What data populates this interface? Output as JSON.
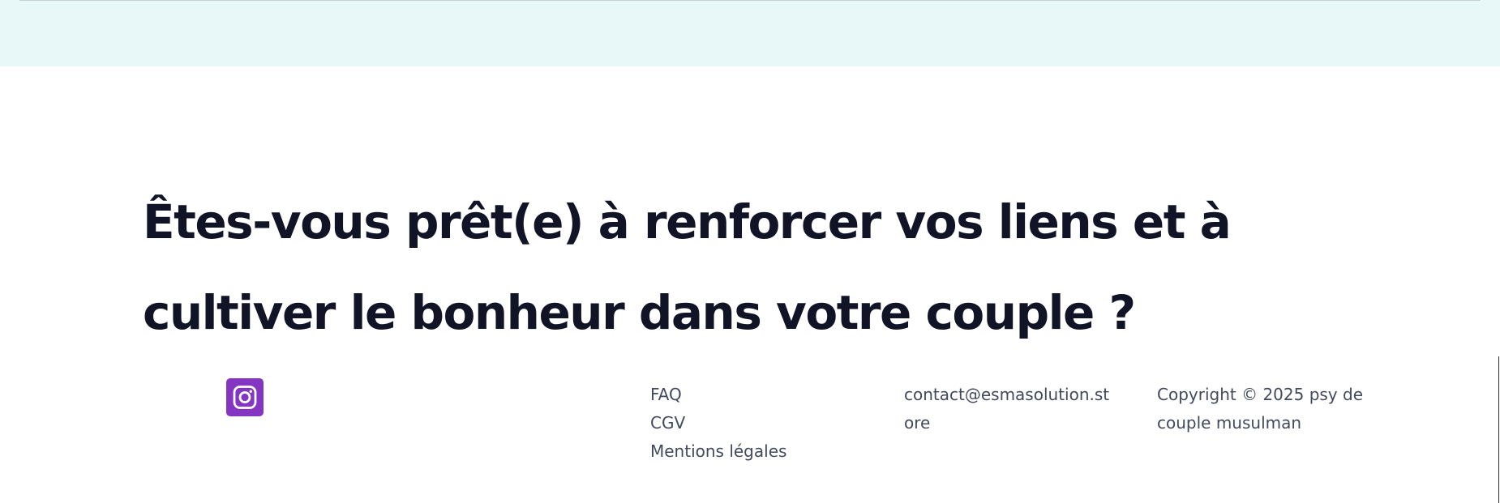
{
  "cta": {
    "heading": "Êtes-vous prêt(e) à renforcer vos liens et à cultiver le bonheur dans votre couple ?"
  },
  "social": {
    "instagram_icon": "instagram-icon",
    "instagram_color": "#8436c2"
  },
  "footer": {
    "links": [
      "FAQ",
      "CGV",
      "Mentions légales"
    ],
    "contact_email": "contact@esmasolution.store",
    "copyright": "Copyright © 2025 psy de couple musulman"
  },
  "colors": {
    "top_band": "#e8f8f8",
    "heading": "#101426",
    "footer_text": "#414a5c"
  }
}
